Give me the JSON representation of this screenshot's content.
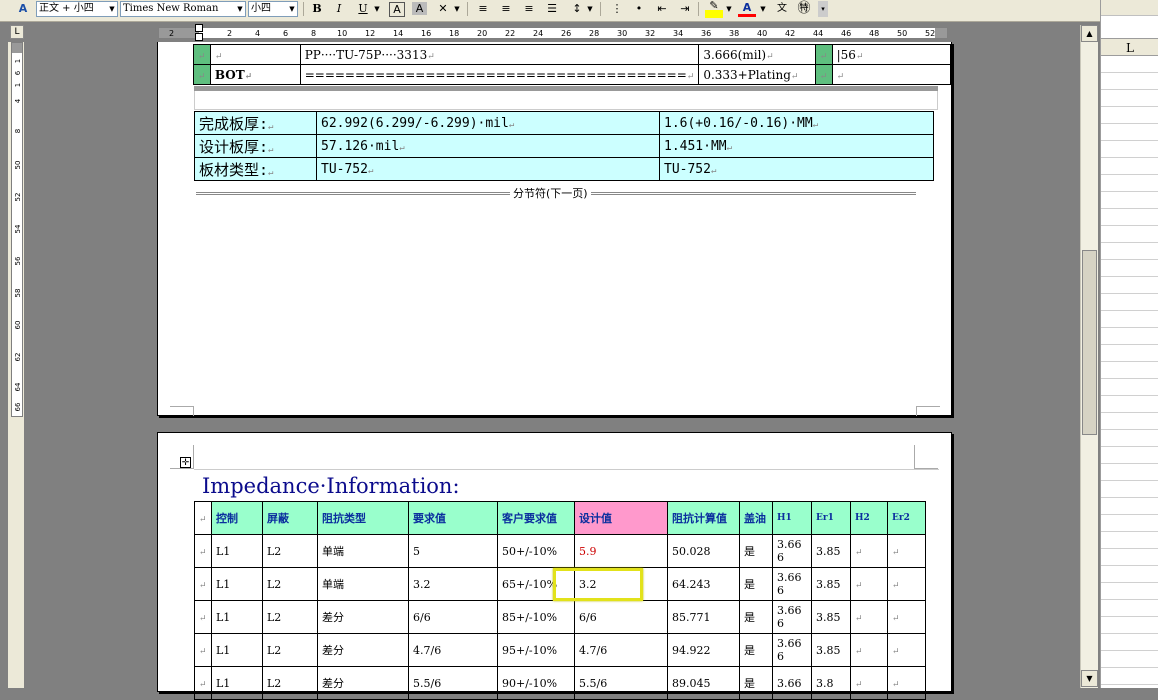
{
  "toolbar": {
    "style_combo": "正文 + 小四",
    "font_combo": "Times New Roman",
    "size_combo": "小四",
    "bold": "B",
    "italic": "I",
    "underline": "U",
    "highlight": "A",
    "font_color": "A",
    "style_icon": "A"
  },
  "right_pane": {
    "column_header": "L"
  },
  "ruler": {
    "horizontal_ticks": [
      "2",
      "2",
      "4",
      "6",
      "8",
      "10",
      "12",
      "14",
      "16",
      "18",
      "20",
      "22",
      "24",
      "26",
      "28",
      "30",
      "32",
      "34",
      "36",
      "38",
      "40",
      "42",
      "44",
      "46",
      "48",
      "50",
      "52"
    ],
    "vertical_ticks": [
      "1",
      "6",
      "1",
      "4",
      "8",
      "50",
      "52",
      "54",
      "56",
      "58",
      "60",
      "62",
      "64",
      "66"
    ]
  },
  "page1": {
    "top_table": [
      [
        "PP····TU-75P····3313",
        "3.666(mil)",
        "56"
      ],
      [
        "BOT",
        "======================================",
        "0.333+Plating",
        ""
      ]
    ],
    "summary_table": [
      [
        "完成板厚:",
        "62.992(6.299/-6.299)·mil",
        "1.6(+0.16/-0.16)·MM"
      ],
      [
        "设计板厚:",
        "57.126·mil",
        "1.451·MM"
      ],
      [
        "板材类型:",
        "TU-752",
        "TU-752"
      ]
    ],
    "section_break": "分节符(下一页)"
  },
  "page2": {
    "title": "Impedance·Information:",
    "headers": [
      "控制",
      "屏蔽",
      "阻抗类型",
      "要求值",
      "客户要求值",
      "设计值",
      "阻抗计算值",
      "盖油",
      "H1",
      "Er1",
      "H2",
      "Er2"
    ],
    "rows": [
      [
        "L1",
        "L2",
        "单端",
        "5",
        "50+/-10%",
        "5.9",
        "50.028",
        "是",
        "3.666",
        "3.85",
        "",
        ""
      ],
      [
        "L1",
        "L2",
        "单端",
        "3.2",
        "65+/-10%",
        "3.2",
        "64.243",
        "是",
        "3.666",
        "3.85",
        "",
        ""
      ],
      [
        "L1",
        "L2",
        "差分",
        "6/6",
        "85+/-10%",
        "6/6",
        "85.771",
        "是",
        "3.666",
        "3.85",
        "",
        ""
      ],
      [
        "L1",
        "L2",
        "差分",
        "4.7/6",
        "95+/-10%",
        "4.7/6",
        "94.922",
        "是",
        "3.666",
        "3.85",
        "",
        ""
      ],
      [
        "L1",
        "L2",
        "差分",
        "5.5/6",
        "90+/-10%",
        "5.5/6",
        "89.045",
        "是",
        "3.66",
        "3.8",
        "",
        ""
      ]
    ]
  },
  "colors": {
    "cyan_cell": "#ccffff",
    "header_green": "#99ffcc",
    "header_pink": "#ff99cc",
    "red_value": "#cc0000",
    "highlight_box": "#e2e21a"
  }
}
